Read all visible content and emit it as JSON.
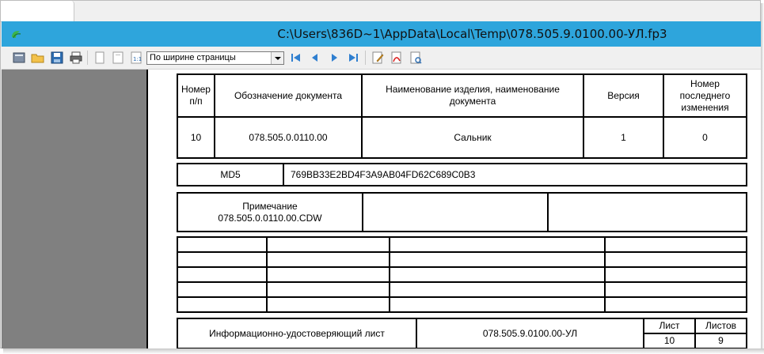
{
  "window": {
    "title": "C:\\Users\\836D~1\\AppData\\Local\\Temp\\078.505.9.0100.00-УЛ.fp3"
  },
  "toolbar": {
    "zoom_value": "По ширине страницы"
  },
  "header_table": {
    "col_number": "Номер п/п",
    "col_designation": "Обозначение документа",
    "col_name": "Наименование изделия, наименование документа",
    "col_version": "Версия",
    "col_last_change": "Номер последнего изменения"
  },
  "item": {
    "number": "10",
    "designation": "078.505.0.0110.00",
    "name": "Сальник",
    "version": "1",
    "last_change": "0"
  },
  "md5": {
    "label": "MD5",
    "value": "769BB33E2BD4F3A9AB04FD62C689C0B3"
  },
  "note": {
    "label": "Примечание",
    "file": "078.505.0.0110.00.CDW"
  },
  "footer": {
    "title": "Информационно-удостоверяющий лист",
    "designation": "078.505.9.0100.00-УЛ",
    "sheet_label": "Лист",
    "sheets_label": "Листов",
    "sheet": "10",
    "sheets": "9"
  }
}
